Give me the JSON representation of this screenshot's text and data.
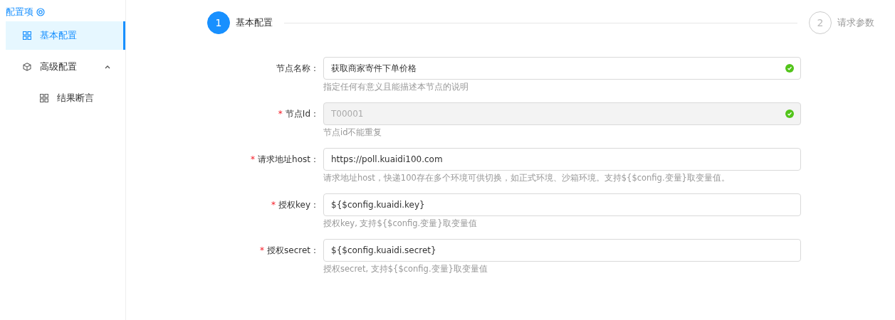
{
  "sidebar": {
    "title": "配置项",
    "items": [
      {
        "label": "基本配置",
        "kind": "grid",
        "selected": true
      },
      {
        "label": "高级配置",
        "kind": "cube",
        "selected": false,
        "expanded": true,
        "children": [
          {
            "label": "结果断言",
            "kind": "grid",
            "selected": false
          }
        ]
      }
    ]
  },
  "steps": [
    {
      "number": "1",
      "label": "基本配置",
      "selected": true
    },
    {
      "number": "2",
      "label": "请求参数",
      "selected": false
    }
  ],
  "form": [
    {
      "label": "节点名称：",
      "value": "获取商家寄件下单价格",
      "disabled": false,
      "valid": true,
      "hint": "指定任何有意义且能描述本节点的说明"
    },
    {
      "label": "节点Id：",
      "required_mark": "*",
      "value": "T00001",
      "disabled": true,
      "valid": true,
      "hint": "节点id不能重复"
    },
    {
      "label": "请求地址host：",
      "required_mark": "*",
      "value": "https://poll.kuaidi100.com",
      "disabled": false,
      "valid": false,
      "hint": "请求地址host，快递100存在多个环境可供切换，如正式环境、沙箱环境。支持${$config.变量}取变量值。"
    },
    {
      "label": "授权key：",
      "required_mark": "*",
      "value": "${$config.kuaidi.key}",
      "disabled": false,
      "valid": false,
      "hint": "授权key, 支持${$config.变量}取变量值"
    },
    {
      "label": "授权secret：",
      "required_mark": "*",
      "value": "${$config.kuaidi.secret}",
      "disabled": false,
      "valid": false,
      "hint": "授权secret, 支持${$config.变量}取变量值"
    }
  ]
}
